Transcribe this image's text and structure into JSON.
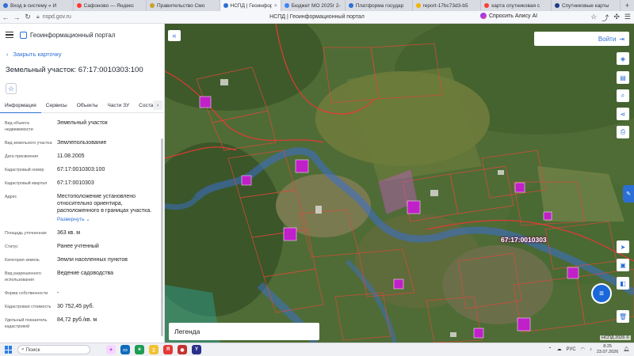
{
  "browser": {
    "tabs": [
      {
        "label": "Вход в систему « И",
        "color": "#2b6fd6"
      },
      {
        "label": "Сафоново — Яндекс",
        "color": "#ff3b30"
      },
      {
        "label": "Правительство Смо",
        "color": "#c9a227"
      },
      {
        "label": "НСПД | Геоинформ",
        "color": "#2b6fd6",
        "active": true
      },
      {
        "label": "Бюджет МО 2025г 2-",
        "color": "#3b82f6"
      },
      {
        "label": "Платформа государ",
        "color": "#2b6fd6"
      },
      {
        "label": "report-17bc73d3-b5",
        "color": "#f0b400"
      },
      {
        "label": "карта спутниковая с",
        "color": "#ff3b30"
      },
      {
        "label": "Спутниковые карты",
        "color": "#1d3a8a"
      }
    ],
    "url": "nspd.gov.ru",
    "page_title": "НСПД | Геоинформационный портал",
    "alice_label": "Спросить Алису AI"
  },
  "sidebar": {
    "portal_name": "Геоинформационный портал",
    "close_card": "Закрыть карточку",
    "title": "Земельный участок: 67:17:0010303:100",
    "tabs": [
      "Информация",
      "Сервисы",
      "Объекты",
      "Части ЗУ",
      "Состав"
    ],
    "fields": [
      {
        "key": "Вид объекта недвижимости",
        "value": "Земельный участок"
      },
      {
        "key": "Вид земельного участка",
        "value": "Землепользование"
      },
      {
        "key": "Дата присвоения",
        "value": "11.08.2005"
      },
      {
        "key": "Кадастровый номер",
        "value": "67:17:0010303:100"
      },
      {
        "key": "Кадастровый квартал",
        "value": "67:17:0010303"
      },
      {
        "key": "Адрес",
        "value": "Местоположение установлено относительно ориентира, расположенного в границах участка."
      },
      {
        "key": "Площадь уточненная",
        "value": "363 кв. м"
      },
      {
        "key": "Статус",
        "value": "Ранее учтенный"
      },
      {
        "key": "Категория земель",
        "value": "Земли населенных пунктов"
      },
      {
        "key": "Вид разрешенного использования",
        "value": "Ведение садоводства"
      },
      {
        "key": "Форма собственности",
        "value": "-"
      },
      {
        "key": "Кадастровая стоимость",
        "value": "30 752,45 руб."
      },
      {
        "key": "Удельный показатель кадастровой",
        "value": "84,72 руб./кв. м"
      }
    ],
    "expand_label": "Развернуть"
  },
  "map": {
    "login_label": "Войти",
    "legend_label": "Легенда",
    "quarter_label": "67:17:0010303",
    "copyright": "НСПД 2026 ©"
  },
  "taskbar": {
    "search_label": "Поиск",
    "lang": "РУС",
    "time": "8:25",
    "date": "23.07.2026"
  }
}
